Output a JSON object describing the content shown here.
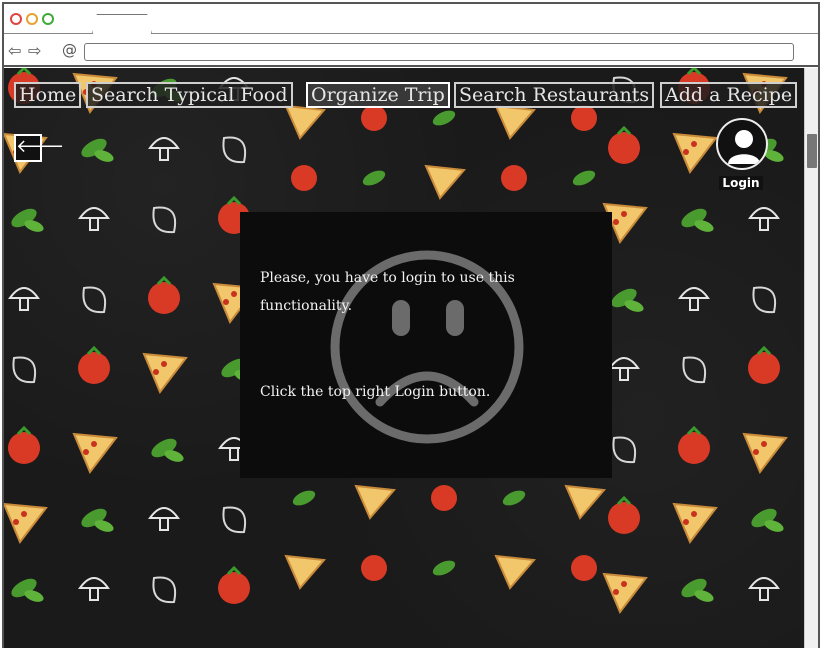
{
  "browser": {
    "url": ""
  },
  "nav": {
    "items": [
      {
        "label": "Home",
        "active": false
      },
      {
        "label": "Search Typical Food",
        "active": false
      },
      {
        "label": "Organize Trip",
        "active": true
      },
      {
        "label": "Search Restaurants",
        "active": false
      },
      {
        "label": "Add a Recipe",
        "active": false
      }
    ]
  },
  "back_icon": "left-arrow-icon",
  "login": {
    "label": "Login",
    "icon": "user-icon"
  },
  "modal": {
    "message_line1": "Please, you have to login to use this functionality.",
    "message_line2": "Click the top right Login button.",
    "icon": "sad-face-icon"
  },
  "colors": {
    "background": "#1a1a1a",
    "modal": "#0c0c0c",
    "text": "#f2f2f2"
  }
}
